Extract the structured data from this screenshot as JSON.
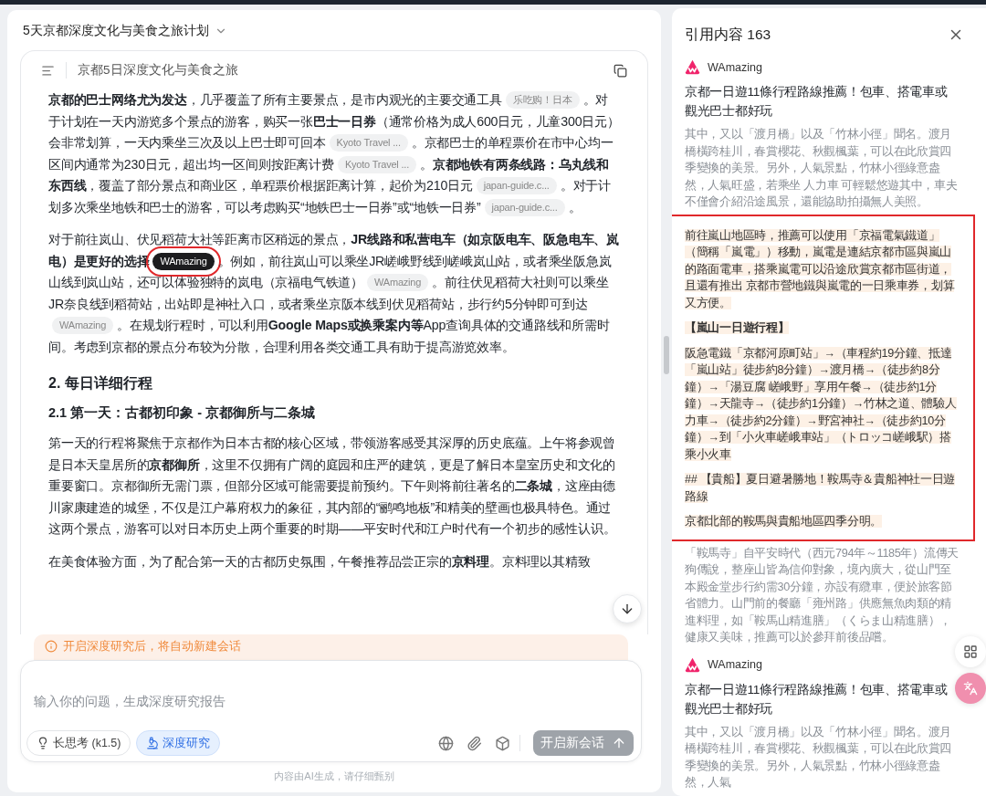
{
  "chat_title": "5天京都深度文化与美食之旅计划",
  "document": {
    "title": "京都5日深度文化与美食之旅",
    "blocks": [
      {
        "kind": "paragraph",
        "segments": [
          {
            "kind": "text",
            "text": "**京都的巴士网络尤为发达**，几乎覆盖了所有主要景点，是市内观光的主要交通工具"
          },
          {
            "kind": "cite",
            "label": "乐吃购！日本",
            "selected": false
          },
          {
            "kind": "text",
            "text": "。对于计划在一天内游览多个景点的游客，购买一张**巴士一日券**（通常价格为成人600日元，儿童300日元）会非常划算，一天内乘坐三次及以上巴士即可回本"
          },
          {
            "kind": "cite",
            "label": "Kyoto Travel ...",
            "selected": false
          },
          {
            "kind": "text",
            "text": "。京都巴士的单程票价在市中心均一区间内通常为230日元，超出均一区间则按距离计费"
          },
          {
            "kind": "cite",
            "label": "Kyoto Travel ...",
            "selected": false
          },
          {
            "kind": "text",
            "text": "。**京都地铁有两条线路：乌丸线和东西线**，覆盖了部分景点和商业区，单程票价根据距离计算，起价为210日元"
          },
          {
            "kind": "cite",
            "label": "japan-guide.c...",
            "selected": false
          },
          {
            "kind": "text",
            "text": "。对于计划多次乘坐地铁和巴士的游客，可以考虑购买“地铁巴士一日券”或“地铁一日券”"
          },
          {
            "kind": "cite",
            "label": "japan-guide.c...",
            "selected": false
          },
          {
            "kind": "text",
            "text": "。"
          }
        ]
      },
      {
        "kind": "paragraph",
        "segments": [
          {
            "kind": "text",
            "text": "对于前往岚山、伏见稻荷大社等距离市区稍远的景点，**JR线路和私营电车（如京阪电车、阪急电车、岚电）是更好的选择**"
          },
          {
            "kind": "cite",
            "label": "WAmazing",
            "selected": true
          },
          {
            "kind": "text",
            "text": "。例如，前往岚山可以乘坐JR嵯峨野线到嵯峨岚山站，或者乘坐阪急岚山线到岚山站，还可以体验独特的岚电（京福电气铁道）"
          },
          {
            "kind": "cite",
            "label": "WAmazing",
            "selected": false
          },
          {
            "kind": "text",
            "text": "。前往伏见稻荷大社则可以乘坐JR奈良线到稻荷站，出站即是神社入口，或者乘坐京阪本线到伏见稻荷站，步行约5分钟即可到达"
          },
          {
            "kind": "cite",
            "label": "WAmazing",
            "selected": false
          },
          {
            "kind": "text",
            "text": "。在规划行程时，可以利用**Google Maps或换乘案内等**App查询具体的交通路线和所需时间。考虑到京都的景点分布较为分散，合理利用各类交通工具有助于提高游览效率。"
          }
        ]
      },
      {
        "kind": "h2",
        "text": "2. 每日详细行程"
      },
      {
        "kind": "h3",
        "text": "2.1 第一天：古都初印象 - 京都御所与二条城"
      },
      {
        "kind": "paragraph",
        "segments": [
          {
            "kind": "text",
            "text": "第一天的行程将聚焦于京都作为日本古都的核心区域，带领游客感受其深厚的历史底蕴。上午将参观曾是日本天皇居所的**京都御所**，这里不仅拥有广阔的庭园和庄严的建筑，更是了解日本皇室历史和文化的重要窗口。京都御所无需门票，但部分区域可能需要提前预约。下午则将前往著名的**二条城**，这座由德川家康建造的城堡，不仅是江户幕府权力的象征，其内部的“鹂鸣地板”和精美的壁画也极具特色。通过这两个景点，游客可以对日本历史上两个重要的时期——平安时代和江户时代有一个初步的感性认识。"
          }
        ]
      },
      {
        "kind": "paragraph",
        "segments": [
          {
            "kind": "text",
            "text": "在美食体验方面，为了配合第一天的古都历史氛围，午餐推荐品尝正宗的**京料理**。京料理以其精致"
          }
        ]
      }
    ]
  },
  "notice": "开启深度研究后，将自动新建会话",
  "composer": {
    "placeholder": "输入你的问题，生成深度研究报告",
    "modes": [
      {
        "label": "长思考 (k1.5)",
        "selected": false
      },
      {
        "label": "深度研究",
        "selected": true
      }
    ],
    "send": {
      "label": "开启新会话",
      "disabled": true
    }
  },
  "disclaimer": "内容由AI生成，请仔细甄别",
  "references": {
    "title": "引用内容 163",
    "cards": [
      {
        "source": "WAmazing",
        "title": "京都一日遊11條行程路線推薦！包車、搭電車或觀光巴士都好玩",
        "groups": [
          {
            "highlighted": false,
            "paragraphs": [
              {
                "kind": "plain",
                "text": "其中，又以「渡月橋」以及「竹林小徑」聞名。渡月橋橫跨桂川，春賞櫻花、秋觀楓葉，可以在此欣賞四季變換的美景。另外，人氣景點，竹林小徑綠意盎然，人氣旺盛，若乘坐 人力車 可輕鬆悠遊其中，車夫不僅會介紹沿途風景，還能協助拍攝無人美照。"
              }
            ]
          },
          {
            "highlighted": true,
            "paragraphs": [
              {
                "kind": "plain",
                "text": "前往嵐山地區時，推薦可以使用「京福電氣鐵道」（簡稱「嵐電」）移動，嵐電是連結京都市區與嵐山的路面電車，搭乘嵐電可以沿途欣賞京都市區街道，且還有推出 京都市營地鐵與嵐電的一日乘車券，划算又方便。"
              },
              {
                "kind": "heading",
                "text": "【嵐山一日遊行程】"
              },
              {
                "kind": "plain",
                "text": "阪急電鐵「京都河原町站」→（車程約19分鐘、抵達「嵐山站」徒步約8分鐘）→渡月橋→（徒步約8分鐘）→「湯豆腐 嵯峨野」享用午餐→（徒步約1分鐘）→天龍寺→（徒步約1分鐘）→竹林之道、體驗人力車→（徒步約2分鐘）→野宮神社→（徒步約10分鐘）→到「小火車嵯峨車站」（トロッコ嵯峨駅）搭乘小火車"
              },
              {
                "kind": "plain",
                "text": "## 【貴船】夏日避暑勝地！鞍馬寺＆貴船神社一日遊路線"
              },
              {
                "kind": "plain",
                "text": "京都北部的鞍馬與貴船地區四季分明。"
              }
            ]
          },
          {
            "highlighted": false,
            "paragraphs": [
              {
                "kind": "plain",
                "text": "「鞍馬寺」自平安時代（西元794年～1185年）流傳天狗傳說，整座山皆為信仰對象，境內廣大，從山門至本殿金堂步行約需30分鐘，亦設有纜車，便於旅客節省體力。山門前的餐廳「雍州路」供應無魚肉類的精進料理，如「鞍馬山精進膳」（くらま山精進膳），健康又美味，推薦可以於參拜前後品嚐。"
              }
            ]
          }
        ]
      },
      {
        "source": "WAmazing",
        "title": "京都一日遊11條行程路線推薦！包車、搭電車或觀光巴士都好玩",
        "groups": [
          {
            "highlighted": false,
            "paragraphs": [
              {
                "kind": "plain",
                "text": "其中，又以「渡月橋」以及「竹林小徑」聞名。渡月橋橫跨桂川，春賞櫻花、秋觀楓葉，可以在此欣賞四季變換的美景。另外，人氣景點，竹林小徑綠意盎然，人氣"
              }
            ]
          }
        ]
      }
    ]
  }
}
